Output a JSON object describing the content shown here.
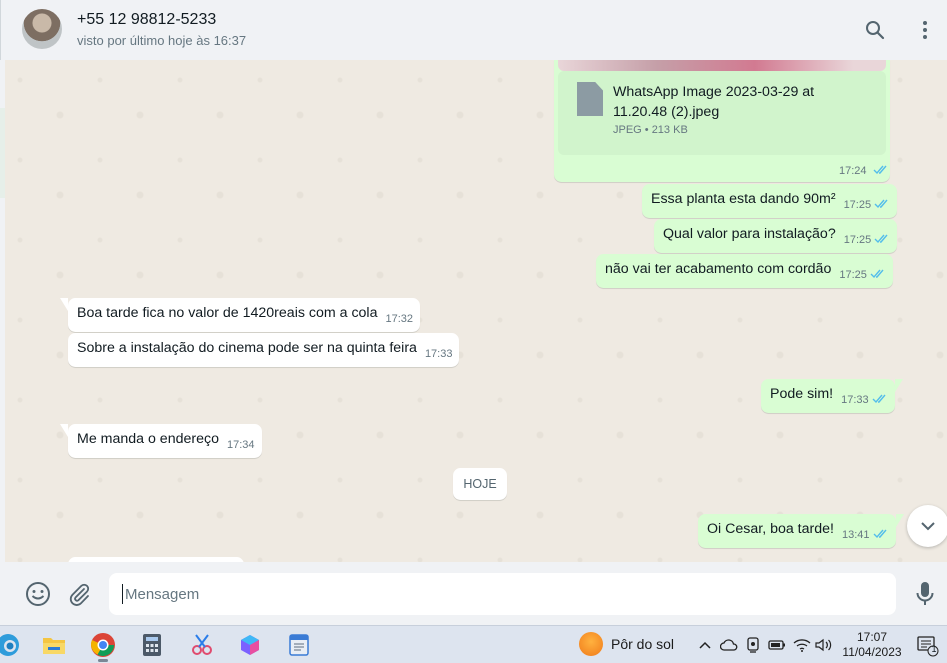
{
  "header": {
    "contact_name": "+55 12 98812-5233",
    "status": "visto por último hoje às 16:37",
    "icons": [
      "search-icon",
      "menu-dots-icon"
    ]
  },
  "file_message": {
    "file_name": "WhatsApp Image 2023-03-29 at 11.20.48 (2).jpeg",
    "file_meta": "JPEG • 213 KB",
    "time": "17:24"
  },
  "messages": [
    {
      "dir": "out",
      "text": "Essa planta esta dando 90m²",
      "time": "17:25"
    },
    {
      "dir": "out",
      "text": "Qual valor para instalação?",
      "time": "17:25"
    },
    {
      "dir": "out",
      "text": "não vai ter acabamento com cordão",
      "time": "17:25"
    },
    {
      "dir": "in",
      "text": "Boa tarde fica no valor de  1420reais com a cola",
      "time": "17:32"
    },
    {
      "dir": "in",
      "text": "Sobre a instalação do cinema pode ser na quinta feira",
      "time": "17:33"
    },
    {
      "dir": "out",
      "text": "Pode sim!",
      "time": "17:33"
    },
    {
      "dir": "in",
      "text": "Me manda o endereço",
      "time": "17:34"
    },
    {
      "dir": "out",
      "text": "Oi Cesar, boa tarde!",
      "time": "13:41"
    }
  ],
  "day_separator": "HOJE",
  "composer": {
    "placeholder": "Mensagem",
    "value": "",
    "icons": [
      "emoji-icon",
      "attach-icon",
      "microphone-icon"
    ]
  },
  "taskbar": {
    "apps": [
      "windows-edge-icon",
      "file-explorer-icon",
      "chrome-icon",
      "calculator-icon",
      "snipping-tool-icon",
      "copilot-icon",
      "notepad-icon"
    ],
    "weather": "Pôr do sol",
    "time": "17:07",
    "date": "11/04/2023",
    "notification_count": "1"
  },
  "colors": {
    "outgoing_bubble": "#d9fdd3",
    "incoming_bubble": "#ffffff",
    "chat_background": "#efeae2",
    "read_ticks": "#53bdeb"
  }
}
